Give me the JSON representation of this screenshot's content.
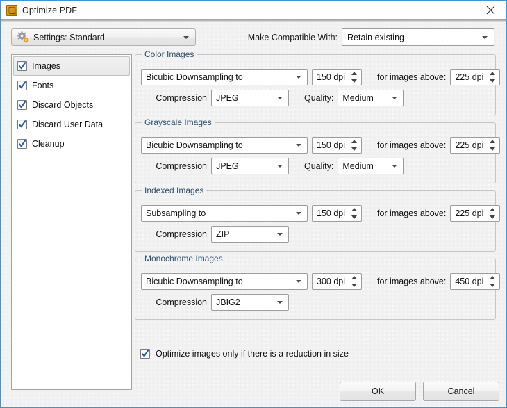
{
  "window": {
    "title": "Optimize PDF",
    "icon": "optimize-pdf-app-icon",
    "close_icon": "close-icon",
    "accent_color": "#3d95d4",
    "background_color": "#f1f1f1"
  },
  "toolbar": {
    "settings_icon": "gears-icon",
    "settings_label": "Settings:  Standard",
    "compat_label": "Make Compatible With:",
    "compat_value": "Retain existing",
    "dropdown_icon": "chevron-down-icon"
  },
  "sidebar": {
    "items": [
      {
        "label": "Images",
        "checked": true,
        "selected": true
      },
      {
        "label": "Fonts",
        "checked": true,
        "selected": false
      },
      {
        "label": "Discard Objects",
        "checked": true,
        "selected": false
      },
      {
        "label": "Discard User Data",
        "checked": true,
        "selected": false
      },
      {
        "label": "Cleanup",
        "checked": true,
        "selected": false
      }
    ]
  },
  "labels": {
    "compression": "Compression",
    "quality": "Quality:",
    "for_images_above": "for images above:"
  },
  "groups": [
    {
      "legend": "Color Images",
      "method": "Bicubic Downsampling to",
      "dpi": "150 dpi",
      "above_dpi": "225 dpi",
      "compression": "JPEG",
      "quality": "Medium",
      "has_quality": true
    },
    {
      "legend": "Grayscale Images",
      "method": "Bicubic Downsampling to",
      "dpi": "150 dpi",
      "above_dpi": "225 dpi",
      "compression": "JPEG",
      "quality": "Medium",
      "has_quality": true
    },
    {
      "legend": "Indexed Images",
      "method": "Subsampling to",
      "dpi": "150 dpi",
      "above_dpi": "225 dpi",
      "compression": "ZIP",
      "quality": "",
      "has_quality": false
    },
    {
      "legend": "Monochrome Images",
      "method": "Bicubic Downsampling to",
      "dpi": "300 dpi",
      "above_dpi": "450 dpi",
      "compression": "JBIG2",
      "quality": "",
      "has_quality": false
    }
  ],
  "optimize_option": {
    "label": "Optimize images only if there is a reduction in size",
    "checked": true
  },
  "footer": {
    "ok_label": "OK",
    "ok_accelerator": "O",
    "cancel_label": "Cancel",
    "cancel_accelerator": "C"
  }
}
